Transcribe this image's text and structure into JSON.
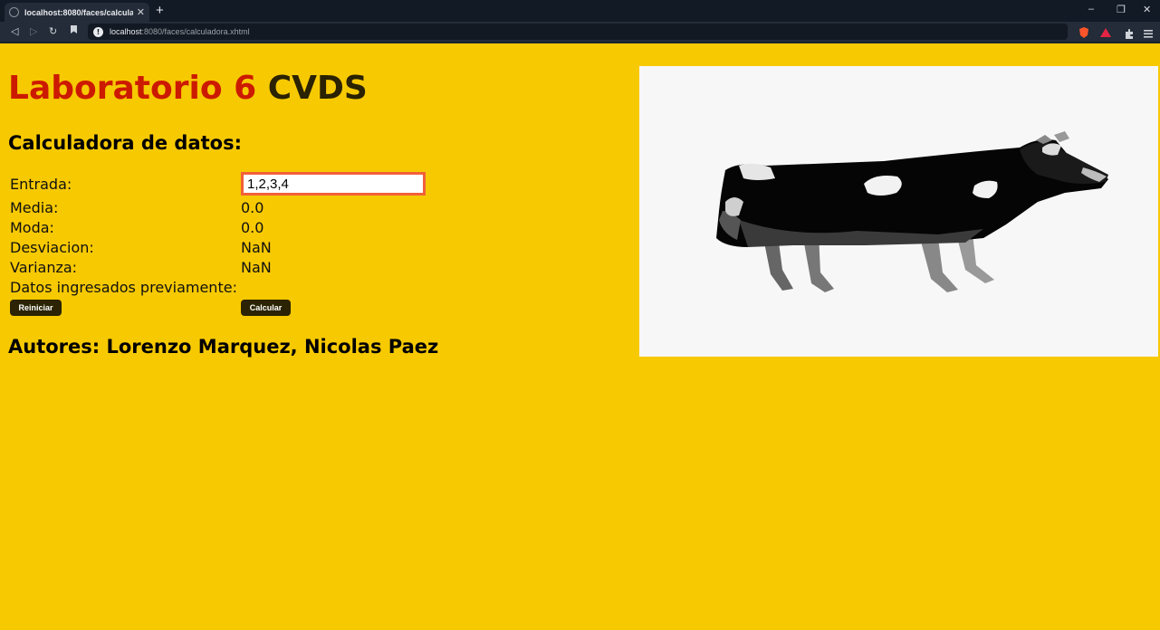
{
  "browser": {
    "tab_title": "localhost:8080/faces/calculadora.xhtml",
    "url_host": "localhost",
    "url_path": ":8080/faces/calculadora.xhtml"
  },
  "page": {
    "title_red": "Laboratorio 6",
    "title_dark": "CVDS",
    "subtitle": "Calculadora de datos:",
    "rows": {
      "entrada_label": "Entrada:",
      "entrada_value": "1,2,3,4",
      "media_label": "Media:",
      "media_value": "0.0",
      "moda_label": "Moda:",
      "moda_value": "0.0",
      "desviacion_label": "Desviacion:",
      "desviacion_value": "NaN",
      "varianza_label": "Varianza:",
      "varianza_value": "NaN",
      "previos_label": "Datos ingresados previamente:"
    },
    "buttons": {
      "reiniciar": "Reiniciar",
      "calcular": "Calcular"
    },
    "authors": "Autores: Lorenzo Marquez, Nicolas Paez"
  },
  "colors": {
    "background": "#f7c900",
    "title_red": "#cc1a00",
    "input_border": "#f2603a",
    "button": "#2b2303"
  }
}
